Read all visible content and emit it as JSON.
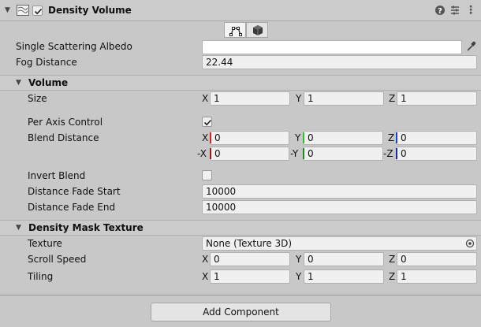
{
  "header": {
    "title": "Density Volume",
    "enabled": true
  },
  "toolbar": {
    "active_tool": "blend-edit",
    "tools": [
      "blend-edit",
      "shape-edit"
    ]
  },
  "properties": {
    "single_scattering_albedo": {
      "label": "Single Scattering Albedo",
      "value": "",
      "color": "#ffffff"
    },
    "fog_distance": {
      "label": "Fog Distance",
      "value": "22.44"
    }
  },
  "volume": {
    "title": "Volume",
    "size": {
      "label": "Size",
      "x_label": "X",
      "y_label": "Y",
      "z_label": "Z",
      "x": "1",
      "y": "1",
      "z": "1"
    },
    "per_axis_control": {
      "label": "Per Axis Control",
      "checked": true
    },
    "blend_distance": {
      "label": "Blend Distance",
      "pos": {
        "x_label": "X",
        "y_label": "Y",
        "z_label": "Z",
        "x": "0",
        "y": "0",
        "z": "0"
      },
      "neg": {
        "x_label": "-X",
        "y_label": "-Y",
        "z_label": "-Z",
        "x": "0",
        "y": "0",
        "z": "0"
      }
    },
    "invert_blend": {
      "label": "Invert Blend",
      "checked": false
    },
    "distance_fade_start": {
      "label": "Distance Fade Start",
      "value": "10000"
    },
    "distance_fade_end": {
      "label": "Distance Fade End",
      "value": "10000"
    }
  },
  "mask": {
    "title": "Density Mask Texture",
    "texture": {
      "label": "Texture",
      "value": "None (Texture 3D)"
    },
    "scroll_speed": {
      "label": "Scroll Speed",
      "x_label": "X",
      "y_label": "Y",
      "z_label": "Z",
      "x": "0",
      "y": "0",
      "z": "0"
    },
    "tiling": {
      "label": "Tiling",
      "x_label": "X",
      "y_label": "Y",
      "z_label": "Z",
      "x": "1",
      "y": "1",
      "z": "1"
    }
  },
  "footer": {
    "add_component_label": "Add Component"
  },
  "colors": {
    "axis_x": "#e02020",
    "axis_y": "#30c030",
    "axis_z": "#2040e0"
  }
}
